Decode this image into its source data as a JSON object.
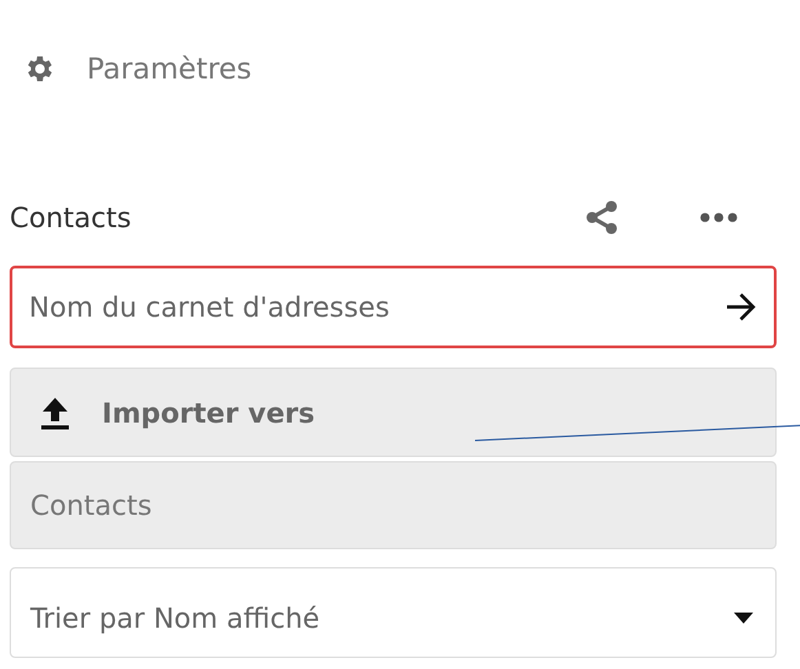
{
  "settings_link": {
    "label": "Paramètres"
  },
  "address_book": {
    "title": "Contacts"
  },
  "name_field": {
    "placeholder": "Nom du carnet d'adresses",
    "focused": true
  },
  "import_button": {
    "label": "Importer vers"
  },
  "import_target": {
    "value": "Contacts",
    "disabled": true
  },
  "sort_select": {
    "value": "Trier par Nom affiché"
  }
}
